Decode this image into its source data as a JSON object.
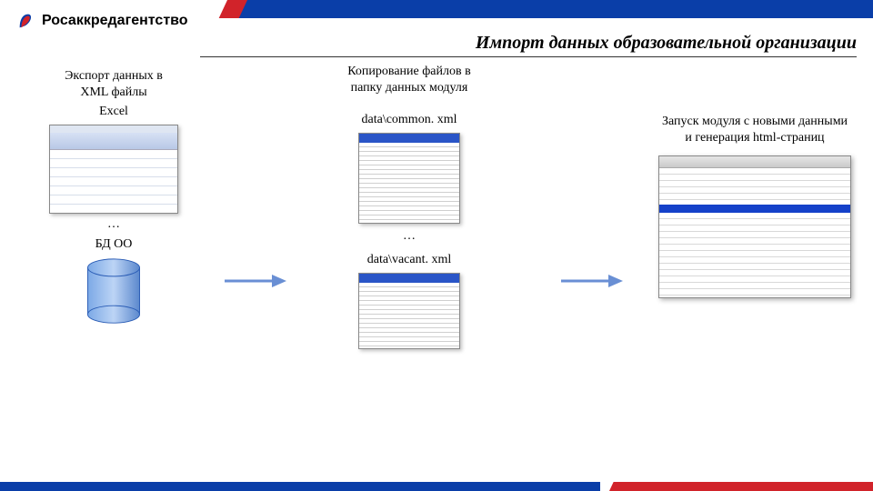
{
  "brand": {
    "name": "Росаккредагентство"
  },
  "page_title": "Импорт данных образовательной организации",
  "col1": {
    "heading": "Экспорт данных в\nXML файлы",
    "app_label": "Excel",
    "ellipsis": "…",
    "db_label": "БД ОО"
  },
  "col2": {
    "heading": "Копирование файлов в\nпапку данных модуля",
    "file1": "data\\common. xml",
    "ellipsis": "…",
    "file2": "data\\vacant. xml"
  },
  "col3": {
    "heading": "Запуск модуля с новыми данными\nи генерация html-страниц"
  },
  "colors": {
    "blue": "#0a3ea8",
    "red": "#d1232a",
    "arrow": "#698fd4"
  }
}
